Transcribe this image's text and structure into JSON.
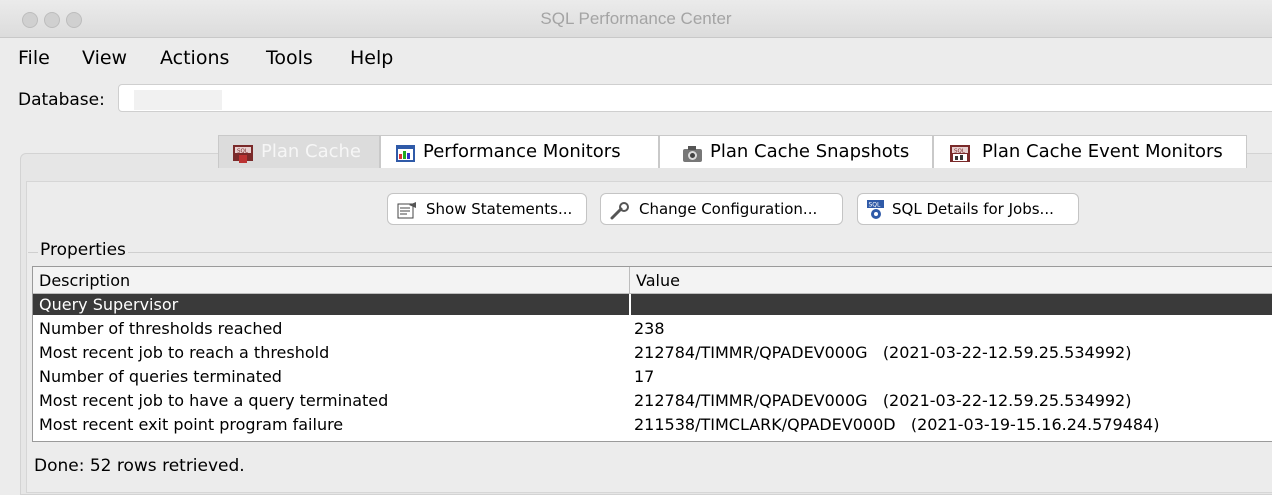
{
  "window": {
    "title": "SQL Performance Center"
  },
  "menu": [
    "File",
    "View",
    "Actions",
    "Tools",
    "Help"
  ],
  "database": {
    "label": "Database:",
    "value": ""
  },
  "tabs": [
    {
      "label": "Plan Cache",
      "selected": true,
      "icon": "sql-stop-icon"
    },
    {
      "label": "Performance Monitors",
      "selected": false,
      "icon": "monitor-chart-icon"
    },
    {
      "label": "Plan Cache Snapshots",
      "selected": false,
      "icon": "camera-icon"
    },
    {
      "label": "Plan Cache Event Monitors",
      "selected": false,
      "icon": "sql-monitor-icon"
    }
  ],
  "actions": [
    {
      "label": "Show Statements...",
      "icon": "statements-icon"
    },
    {
      "label": "Change Configuration...",
      "icon": "wrench-icon"
    },
    {
      "label": "SQL Details for Jobs...",
      "icon": "sql-gear-icon"
    }
  ],
  "properties": {
    "title": "Properties",
    "columns": [
      "Description",
      "Value"
    ],
    "rows": [
      {
        "description": "Query Supervisor",
        "value": "",
        "group": true
      },
      {
        "description": "Number of thresholds reached",
        "value": "238"
      },
      {
        "description": "Most recent job to reach a threshold",
        "value": "212784/TIMMR/QPADEV000G   (2021-03-22-12.59.25.534992)"
      },
      {
        "description": "Number of queries terminated",
        "value": "17"
      },
      {
        "description": "Most recent job to have a query terminated",
        "value": "212784/TIMMR/QPADEV000G   (2021-03-22-12.59.25.534992)"
      },
      {
        "description": "Most recent exit point program failure",
        "value": "211538/TIMCLARK/QPADEV000D   (2021-03-19-15.16.24.579484)"
      }
    ]
  },
  "status": "Done: 52 rows retrieved.",
  "colors": {
    "group_row": "#3a3a3a",
    "window_bg": "#ececec"
  }
}
